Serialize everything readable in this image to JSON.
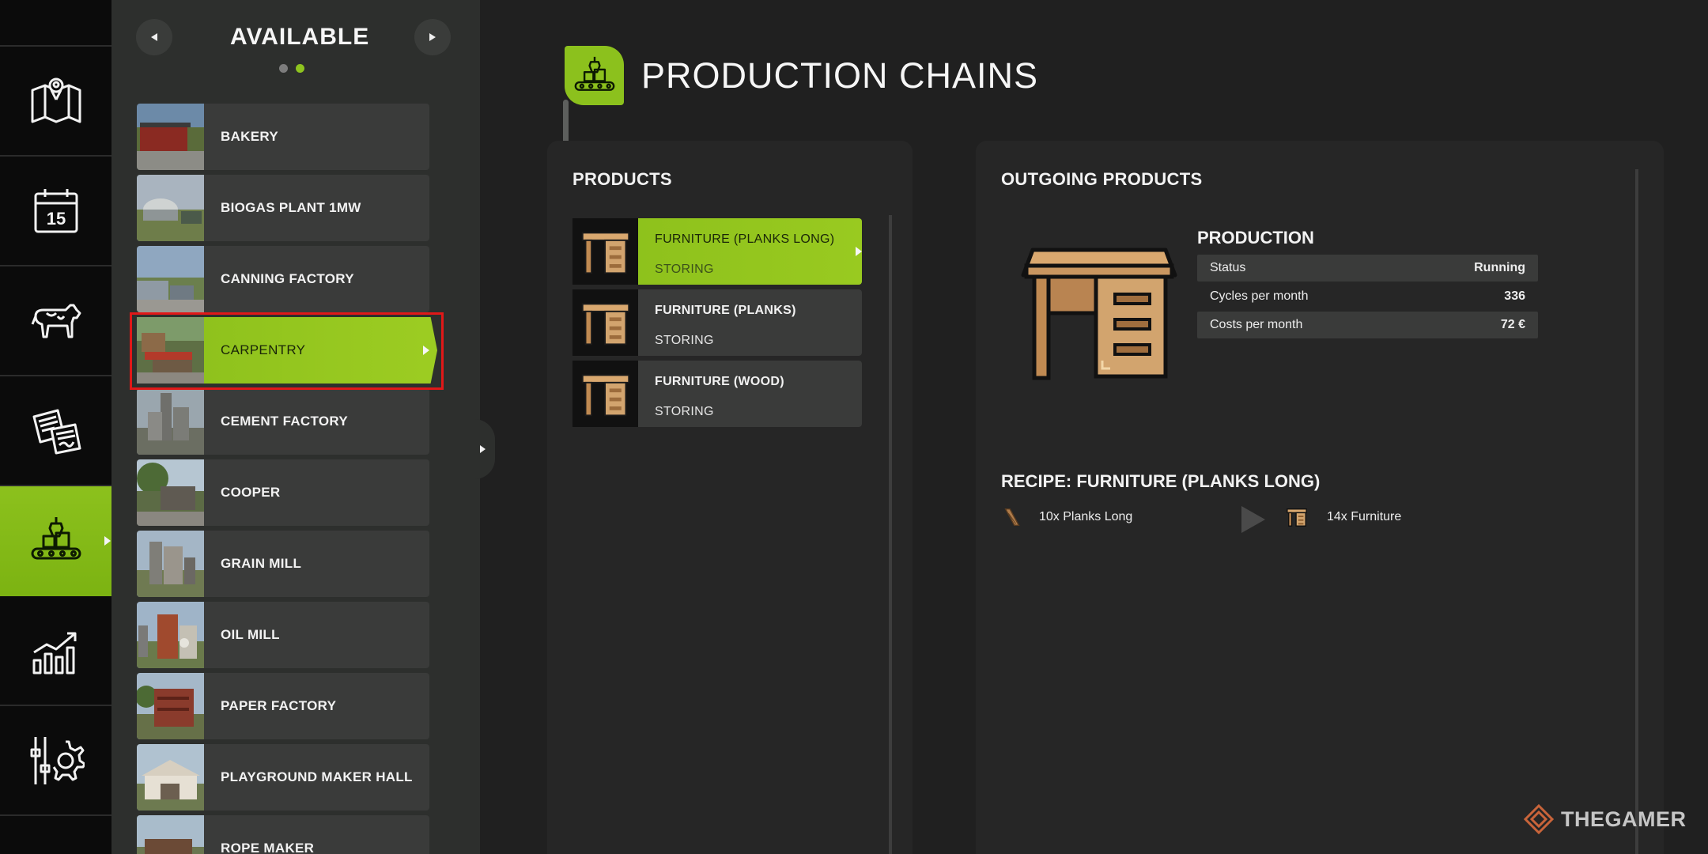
{
  "rail": {
    "items": [
      {
        "name": "map",
        "icon": "map-icon"
      },
      {
        "name": "calendar",
        "icon": "calendar-icon",
        "icon_text": "15"
      },
      {
        "name": "animals",
        "icon": "cow-icon"
      },
      {
        "name": "contracts",
        "icon": "contracts-icon"
      },
      {
        "name": "production",
        "icon": "production-icon",
        "active": true
      },
      {
        "name": "statistics",
        "icon": "chart-icon"
      },
      {
        "name": "settings",
        "icon": "settings-gear-icon"
      }
    ]
  },
  "available": {
    "title": "AVAILABLE",
    "page_count": 2,
    "active_page": 2,
    "items": [
      {
        "label": "BAKERY"
      },
      {
        "label": "BIOGAS PLANT 1MW"
      },
      {
        "label": "CANNING FACTORY"
      },
      {
        "label": "CARPENTRY",
        "active": true
      },
      {
        "label": "CEMENT FACTORY"
      },
      {
        "label": "COOPER"
      },
      {
        "label": "GRAIN MILL"
      },
      {
        "label": "OIL MILL"
      },
      {
        "label": "PAPER FACTORY"
      },
      {
        "label": "PLAYGROUND MAKER HALL"
      },
      {
        "label": "ROPE MAKER"
      }
    ]
  },
  "header": {
    "title": "PRODUCTION CHAINS"
  },
  "products": {
    "title": "PRODUCTS",
    "items": [
      {
        "name": "FURNITURE (PLANKS LONG)",
        "state": "STORING",
        "active": true
      },
      {
        "name": "FURNITURE (PLANKS)",
        "state": "STORING"
      },
      {
        "name": "FURNITURE (WOOD)",
        "state": "STORING"
      }
    ]
  },
  "outgoing": {
    "title": "OUTGOING PRODUCTS",
    "production_heading": "PRODUCTION",
    "stats": [
      {
        "label": "Status",
        "value": "Running"
      },
      {
        "label": "Cycles per month",
        "value": "336"
      },
      {
        "label": "Costs per month",
        "value": "72 €"
      }
    ],
    "recipe_title": "RECIPE: FURNITURE (PLANKS LONG)",
    "recipe_input": "10x Planks Long",
    "recipe_output": "14x Furniture"
  },
  "watermark": {
    "text": "THEGAMER"
  },
  "colors": {
    "accent": "#8cc11d",
    "highlight": "#e01818",
    "panel": "#262626",
    "desk": "#d2a46e"
  }
}
